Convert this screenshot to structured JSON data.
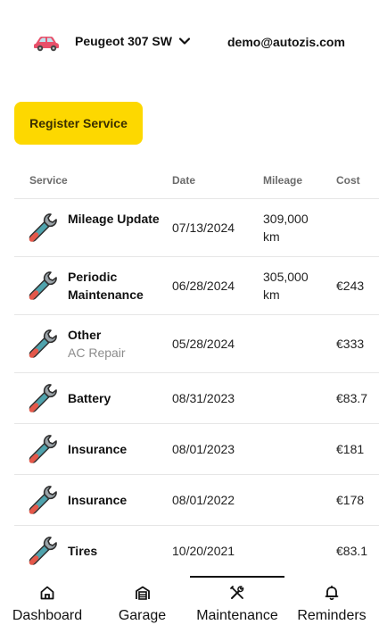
{
  "header": {
    "car_name": "Peugeot 307 SW",
    "user_email": "demo@autozis.com"
  },
  "actions": {
    "register_label": "Register Service"
  },
  "table": {
    "columns": [
      "Service",
      "Date",
      "Mileage",
      "Cost"
    ],
    "rows": [
      {
        "service": "Mileage Update",
        "sub": "",
        "date": "07/13/2024",
        "mileage": "309,000 km",
        "cost": ""
      },
      {
        "service": "Periodic Maintenance",
        "sub": "",
        "date": "06/28/2024",
        "mileage": "305,000 km",
        "cost": "€243"
      },
      {
        "service": "Other",
        "sub": "AC Repair",
        "date": "05/28/2024",
        "mileage": "",
        "cost": "€333"
      },
      {
        "service": "Battery",
        "sub": "",
        "date": "08/31/2023",
        "mileage": "",
        "cost": "€83.7"
      },
      {
        "service": "Insurance",
        "sub": "",
        "date": "08/01/2023",
        "mileage": "",
        "cost": "€181"
      },
      {
        "service": "Insurance",
        "sub": "",
        "date": "08/01/2022",
        "mileage": "",
        "cost": "€178"
      },
      {
        "service": "Tires",
        "sub": "",
        "date": "10/20/2021",
        "mileage": "",
        "cost": "€83.1"
      }
    ]
  },
  "nav": {
    "items": [
      {
        "label": "Dashboard",
        "icon": "home-icon"
      },
      {
        "label": "Garage",
        "icon": "garage-icon"
      },
      {
        "label": "Maintenance",
        "icon": "tools-icon",
        "active": true
      },
      {
        "label": "Reminders",
        "icon": "bell-icon"
      }
    ]
  },
  "colors": {
    "accent": "#fdd800",
    "car": "#e8506a",
    "wrench_handle": "#4fa3ad",
    "wrench_tip": "#e4584a"
  }
}
